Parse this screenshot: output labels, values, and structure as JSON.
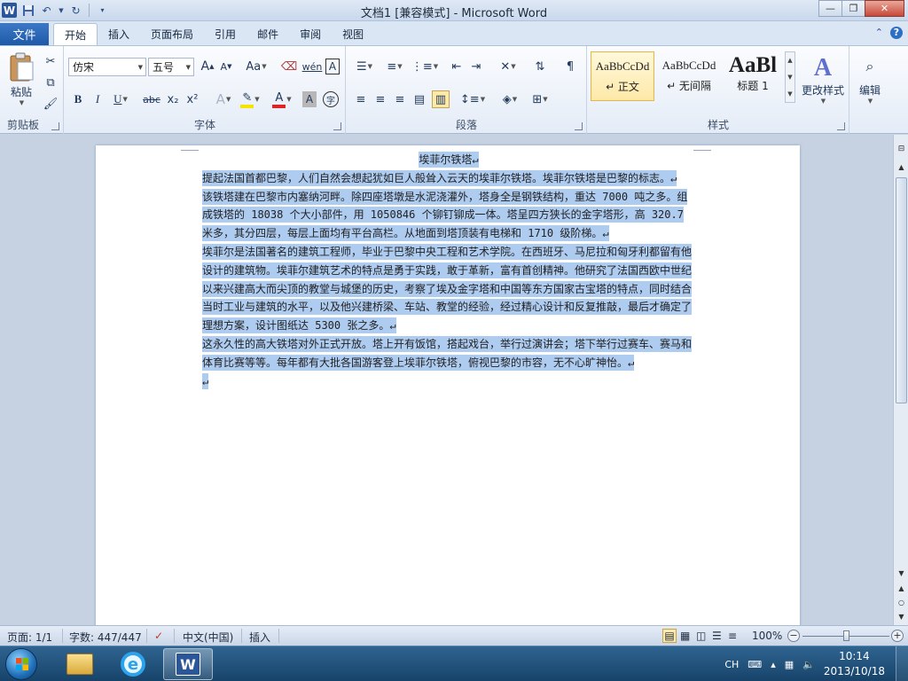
{
  "window": {
    "title": "文档1 [兼容模式] - Microsoft Word",
    "logo": "W",
    "minimize": "—",
    "maximize": "❐",
    "close": "✕"
  },
  "tabs": {
    "file": "文件",
    "items": [
      "开始",
      "插入",
      "页面布局",
      "引用",
      "邮件",
      "审阅",
      "视图"
    ],
    "active": "开始"
  },
  "ribbon": {
    "clipboard": {
      "paste": "粘贴",
      "label": "剪贴板"
    },
    "font": {
      "name": "仿宋",
      "size": "五号",
      "label": "字体",
      "bold": "B",
      "italic": "I",
      "underline": "U",
      "strike": "abc",
      "subscript": "x₂",
      "superscript": "x²",
      "grow": "A",
      "shrink": "A",
      "change_case": "Aa",
      "phonetic": "wén",
      "border_char": "A",
      "text_effect": "A",
      "font_color": "A",
      "char_shading": "A",
      "enclose": "字"
    },
    "paragraph": {
      "label": "段落"
    },
    "styles": {
      "label": "样式",
      "items": [
        {
          "sample": "AaBbCcDd",
          "name": "↵ 正文"
        },
        {
          "sample": "AaBbCcDd",
          "name": "↵ 无间隔"
        },
        {
          "sample": "AaBl",
          "name": "标题 1"
        }
      ],
      "change_styles": "更改样式"
    },
    "editing": {
      "label": "编辑"
    }
  },
  "document": {
    "title": "埃菲尔铁塔↵",
    "paragraphs": [
      "提起法国首都巴黎，人们自然会想起犹如巨人般耸入云天的埃菲尔铁塔。埃菲尔铁塔是巴黎的标志。↵",
      "该铁塔建在巴黎市内塞纳河畔。除四座塔墩是水泥浇灌外，塔身全是钢铁结构，重达 7000 吨之多。组成铁塔的 18038 个大小部件，用 1050846 个铆钉铆成一体。塔呈四方狭长的金字塔形，高 320.7 米多，其分四层，每层上面均有平台高栏。从地面到塔顶装有电梯和 1710 级阶梯。↵",
      "埃菲尔是法国著名的建筑工程师，毕业于巴黎中央工程和艺术学院。在西班牙、马尼拉和匈牙利都留有他设计的建筑物。埃菲尔建筑艺术的特点是勇于实践，敢于革新，富有首创精神。他研究了法国西欧中世纪以来兴建高大而尖顶的教堂与城堡的历史，考察了埃及金字塔和中国等东方国家古宝塔的特点，同时结合当时工业与建筑的水平，以及他兴建桥梁、车站、教堂的经验，经过精心设计和反复推敲，最后才确定了理想方案，设计图纸达 5300 张之多。↵",
      "这永久性的高大铁塔对外正式开放。塔上开有饭馆，搭起戏台，举行过演讲会；塔下举行过赛车、赛马和体育比赛等等。每年都有大批各国游客登上埃菲尔铁塔，俯视巴黎的市容，无不心旷神怡。↵",
      "↵"
    ]
  },
  "statusbar": {
    "page": "页面: 1/1",
    "words": "字数: 447/447",
    "language": "中文(中国)",
    "mode": "插入",
    "zoom": "100%",
    "zoom_minus": "−",
    "zoom_plus": "+",
    "zoom_level_percent": 100
  },
  "taskbar": {
    "tray_lang": "CH",
    "time": "10:14",
    "date": "2013/10/18"
  }
}
